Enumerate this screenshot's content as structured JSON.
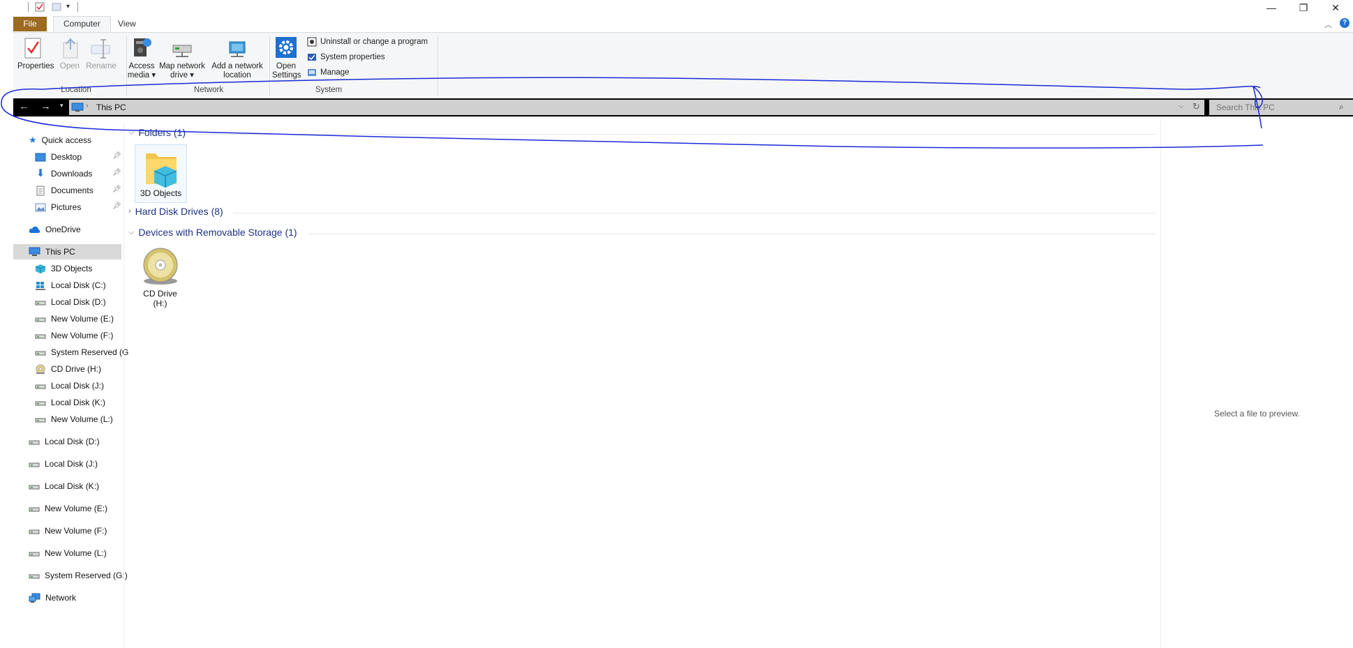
{
  "titlebar": {
    "minimize_label": "—",
    "restore_label": "❐",
    "close_label": "✕",
    "help_label": "?"
  },
  "ribbon": {
    "tabs": [
      {
        "label": "File"
      },
      {
        "label": "Computer"
      },
      {
        "label": "View"
      }
    ],
    "location": {
      "properties": "Properties",
      "open": "Open",
      "rename": "Rename",
      "group": "Location"
    },
    "network": {
      "access_media": "Access",
      "access_media_2": "media ▾",
      "map_drive": "Map network",
      "map_drive_2": "drive ▾",
      "add_location": "Add a network",
      "add_location_2": "location",
      "group": "Network"
    },
    "system": {
      "open_settings": "Open",
      "open_settings_2": "Settings",
      "uninstall": "Uninstall or change a program",
      "system_properties": "System properties",
      "manage": "Manage",
      "group": "System"
    }
  },
  "address": {
    "path": "This PC",
    "search_placeholder": "Search This PC"
  },
  "nav": {
    "quick_access": "Quick access",
    "quick_items": [
      "Desktop",
      "Downloads",
      "Documents",
      "Pictures"
    ],
    "onedrive": "OneDrive",
    "this_pc": "This PC",
    "pc_items": [
      "3D Objects",
      "Local Disk (C:)",
      "Local Disk (D:)",
      "New Volume (E:)",
      "New Volume (F:)",
      "System Reserved (G",
      "CD Drive (H:)",
      "Local Disk (J:)",
      "Local Disk (K:)",
      "New Volume (L:)"
    ],
    "drives": [
      "Local Disk (D:)",
      "Local Disk (J:)",
      "Local Disk (K:)",
      "New Volume (E:)",
      "New Volume (F:)",
      "New Volume (L:)",
      "System Reserved (G:)"
    ],
    "network": "Network"
  },
  "content": {
    "folders_head": "Folders (1)",
    "folder_tile": "3D Objects",
    "hdd_head": "Hard Disk Drives (8)",
    "removable_head": "Devices with Removable Storage (1)",
    "cd_tile_1": "CD Drive",
    "cd_tile_2": "(H:)"
  },
  "preview": {
    "text": "Select a file to preview."
  },
  "colors": {
    "file_tab": "#9c6a20",
    "section_text": "#1e3287",
    "annotation": "#1a2ad6"
  }
}
